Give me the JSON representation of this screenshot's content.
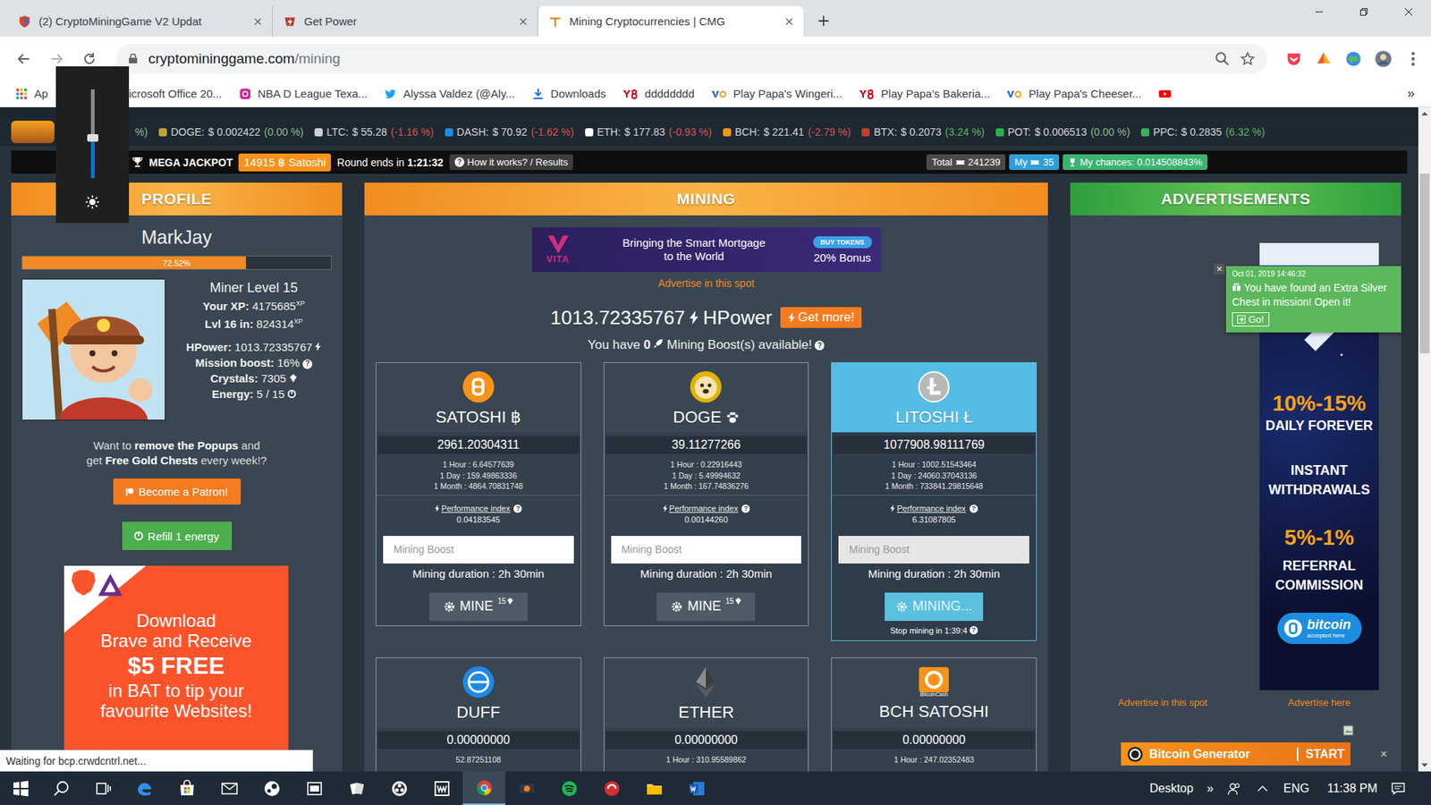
{
  "browser": {
    "tabs": [
      {
        "label": "(2) CryptoMiningGame V2 Updat",
        "selected": false,
        "kind": "cmg"
      },
      {
        "label": "Get Power",
        "selected": false,
        "kind": "power"
      },
      {
        "label": "Mining Cryptocurrencies | CMG",
        "selected": true,
        "kind": "mining"
      }
    ],
    "url_host": "cryptomininggame.com",
    "url_path": "/mining",
    "bookmarks": [
      {
        "label": "Ap",
        "kind": "apps"
      },
      {
        "label": "icrosoft Office 20...",
        "kind": "covered"
      },
      {
        "label": "NBA D League Texa...",
        "kind": "instagram"
      },
      {
        "label": "Alyssa Valdez (@Aly...",
        "kind": "twitter"
      },
      {
        "label": "Downloads",
        "kind": "download"
      },
      {
        "label": "dddddddd",
        "kind": "y8"
      },
      {
        "label": "Play Papa's Wingeri...",
        "kind": "papa"
      },
      {
        "label": "Play Papa's Bakeria...",
        "kind": "y8"
      },
      {
        "label": "Play Papa's Cheeser...",
        "kind": "papa"
      }
    ],
    "more": "»"
  },
  "scrollbar": {
    "offset": 0.1,
    "size": 0.27
  },
  "ticker": {
    "tail": {
      "text": "%)",
      "trend": "flat"
    },
    "items": [
      {
        "label": "DOGE:",
        "price": "$ 0.002422",
        "change": "(0.00 %)",
        "trend": "flat",
        "color": "#c2a633"
      },
      {
        "label": "LTC:",
        "price": "$ 55.28",
        "change": "(-1.16 %)",
        "trend": "down",
        "color": "#d0d0d0"
      },
      {
        "label": "DASH:",
        "price": "$ 70.92",
        "change": "(-1.62 %)",
        "trend": "down",
        "color": "#1c8de0"
      },
      {
        "label": "ETH:",
        "price": "$ 177.83",
        "change": "(-0.93 %)",
        "trend": "down",
        "color": "#ffffff"
      },
      {
        "label": "BCH:",
        "price": "$ 221.41",
        "change": "(-2.79 %)",
        "trend": "down",
        "color": "#f7931a"
      },
      {
        "label": "BTX:",
        "price": "$ 0.2073",
        "change": "(3.24 %)",
        "trend": "up",
        "color": "#c2412b"
      },
      {
        "label": "POT:",
        "price": "$ 0.006513",
        "change": "(0.00 %)",
        "trend": "flat",
        "color": "#2bb24c"
      },
      {
        "label": "PPC:",
        "price": "$ 0.2835",
        "change": "(6.32 %)",
        "trend": "up",
        "color": "#3cb054"
      }
    ]
  },
  "jackpot": {
    "title": "MEGA JACKPOT",
    "prize": "14915 ฿ Satoshi",
    "round": "Round ends in",
    "time": "1:21:32",
    "help": "How it works? / Results",
    "total_label": "Total",
    "total": "241239",
    "my_label": "My",
    "my": "35",
    "chances": "My chances: 0.014508843%"
  },
  "help": "?",
  "profile": {
    "header": "PROFILE",
    "name": "MarkJay",
    "xp_level": 0.7252,
    "xp_percent": "72.52%",
    "level": "Miner Level 15",
    "xp": [
      {
        "label": "Your XP:",
        "value": "4175685",
        "suffix": "XP"
      },
      {
        "label": "Lvl 16 in:",
        "value": "824314",
        "suffix": "XP"
      }
    ],
    "hpower_label": "HPower:",
    "hpower": "1013.72335767",
    "mission_label": "Mission boost:",
    "mission": "16%",
    "crystals_label": "Crystals:",
    "crystals": "7305",
    "energy_label": "Energy:",
    "energy": "5 / 15",
    "promo": [
      [
        {
          "text": "Want to ",
          "bold": false
        },
        {
          "text": "remove the Popups",
          "bold": true
        },
        {
          "text": " and",
          "bold": false
        }
      ],
      [
        {
          "text": "get ",
          "bold": false
        },
        {
          "text": "Free Gold Chests",
          "bold": true
        },
        {
          "text": " every week!?",
          "bold": false
        }
      ]
    ],
    "patron": "Become a Patron!",
    "refill": "Refill 1 energy",
    "brave": {
      "lines": [
        "Download",
        "Brave and Receive"
      ],
      "amount": "$5 FREE",
      "lines2": [
        "in BAT to tip your",
        "favourite Websites!"
      ]
    }
  },
  "mining": {
    "header": "MINING",
    "banner": {
      "brand": "VITA",
      "headline": [
        "Bringing the Smart Mortgage",
        "to the World"
      ],
      "cta": "BUY TOKENS",
      "bonus": "20% Bonus"
    },
    "advertise": "Advertise in this spot",
    "hpower": "1013.72335767",
    "hpower_unit": "HPower",
    "get_more": "Get more!",
    "boost_pre": "You have",
    "boost_count": "0",
    "boost_post": "Mining Boost(s) available!",
    "cards": [
      {
        "name": "SATOSHI",
        "symbol": "฿",
        "kind": "bitcoin",
        "balance": "2961.20304311",
        "rates": [
          "1 Hour : 6.64577639",
          "1 Day : 159.49863336",
          "1 Month : 4864.70831748"
        ],
        "perf_label": "Performance index",
        "perf": "0.04183545",
        "boost_placeholder": "Mining Boost",
        "duration": "Mining duration : 2h 30min",
        "button": "MINE",
        "cost": "15",
        "selected": false,
        "mining": false
      },
      {
        "name": "DOGE",
        "kind": "doge",
        "balance": "39.11277266",
        "rates": [
          "1 Hour : 0.22916443",
          "1 Day : 5.49994632",
          "1 Month : 167.74836276"
        ],
        "perf_label": "Performance index",
        "perf": "0.00144260",
        "boost_placeholder": "Mining Boost",
        "duration": "Mining duration : 2h 30min",
        "button": "MINE",
        "cost": "15",
        "selected": false,
        "mining": false
      },
      {
        "name": "LITOSHI",
        "symbol": "Ł",
        "kind": "litecoin",
        "balance": "1077908.98111769",
        "rates": [
          "1 Hour : 1002.51543464",
          "1 Day : 24060.37043136",
          "1 Month : 733841.29815648"
        ],
        "perf_label": "Performance index",
        "perf": "6.31087805",
        "boost_placeholder": "Mining Boost",
        "duration": "Mining duration : 2h 30min",
        "button": "MINING...",
        "status": "Stop mining in 1:39:4",
        "selected": true,
        "mining": true
      },
      {
        "name": "DUFF",
        "kind": "duff",
        "balance": "0.00000000",
        "rates": [
          "52.87251108"
        ],
        "selected": false,
        "mining": false
      },
      {
        "name": "ETHER",
        "kind": "ether",
        "balance": "0.00000000",
        "rates": [
          "1 Hour : 310.95589862"
        ],
        "selected": false,
        "mining": false
      },
      {
        "name": "BCH SATOSHI",
        "kind": "bch",
        "icon_caption": "BitcoinCash",
        "balance": "0.00000000",
        "rates": [
          "1 Hour : 247.02352483"
        ],
        "selected": false,
        "mining": false
      }
    ]
  },
  "ads": {
    "header": "ADVERTISEMENTS",
    "banner": {
      "rate": "10%-15%",
      "rate_label": "DAILY FOREVER",
      "instant": [
        "INSTANT",
        "WITHDRAWALS"
      ],
      "ref": "5%-1%",
      "ref_label": [
        "REFERRAL",
        "COMMISSION"
      ],
      "badge": "bitcoin",
      "badge_sub": "accepted here"
    },
    "advertise_spot": "Advertise in this spot",
    "advertise_here": "Advertise here",
    "generator": {
      "label": "Bitcoin Generator",
      "cta": "START",
      "close": "×"
    }
  },
  "notification": {
    "date": "Oct 01, 2019 14:46:32",
    "message": "You have found an Extra Silver Chest in mission! Open it!",
    "button": "Go!",
    "close": "×"
  },
  "brightness": {
    "level": 0.45
  },
  "status": "Waiting for bcp.crwdcntrl.net...",
  "taskbar": {
    "apps": [
      {
        "kind": "edge",
        "selected": false
      },
      {
        "kind": "store",
        "selected": false
      },
      {
        "kind": "mail",
        "selected": false
      },
      {
        "kind": "steam",
        "selected": false
      },
      {
        "kind": "vm",
        "selected": false
      },
      {
        "kind": "cards",
        "selected": false
      },
      {
        "kind": "obs",
        "selected": false
      },
      {
        "kind": "wd",
        "selected": false
      },
      {
        "kind": "chrome",
        "selected": true
      },
      {
        "kind": "fox",
        "selected": false
      },
      {
        "kind": "spotify",
        "selected": false
      },
      {
        "kind": "red",
        "selected": false
      },
      {
        "kind": "explorer",
        "selected": false
      },
      {
        "kind": "word",
        "selected": false
      }
    ],
    "desktop": "Desktop",
    "more": "»",
    "lang": "ENG",
    "time": "11:38 PM"
  }
}
